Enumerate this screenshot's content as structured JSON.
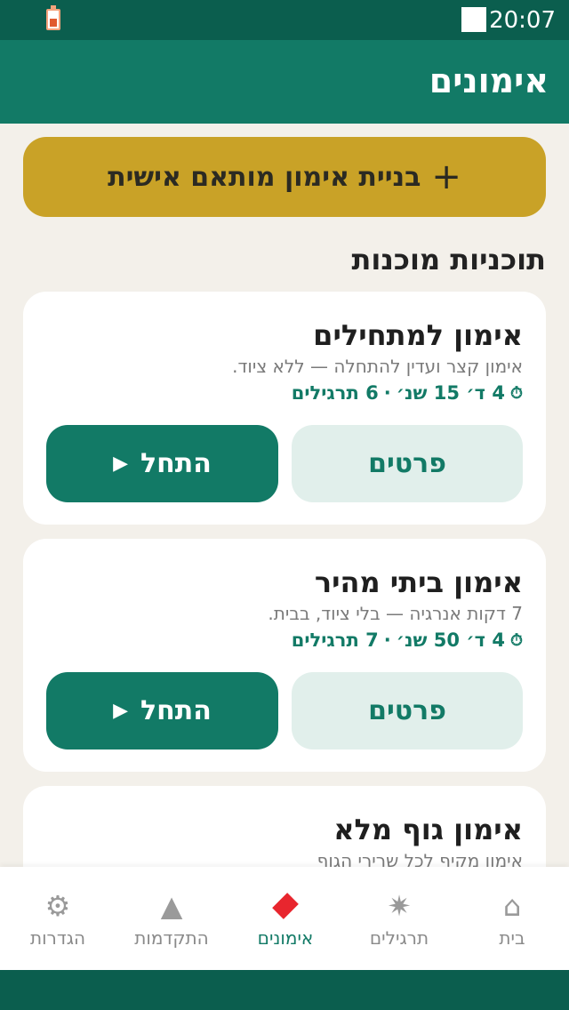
{
  "status_bar": {
    "time": "20:07"
  },
  "app_bar": {
    "title": "אימונים"
  },
  "build_button": {
    "icon": "plus-icon",
    "label": "בניית אימון מותאם אישית"
  },
  "section": {
    "title": "תוכניות מוכנות"
  },
  "workouts": [
    {
      "title": "אימון למתחילים",
      "description": "אימון קצר ועדין להתחלה — ללא ציוד.",
      "duration": "4 ד׳ 15 שנ׳",
      "separator": "·",
      "exercises": "6 תרגילים",
      "details_label": "פרטים",
      "start_label": "התחל"
    },
    {
      "title": "אימון ביתי מהיר",
      "description": "7 דקות אנרגיה — בלי ציוד, בבית.",
      "duration": "4 ד׳ 50 שנ׳",
      "separator": "·",
      "exercises": "7 תרגילים",
      "details_label": "פרטים",
      "start_label": "התחל"
    },
    {
      "title": "אימון גוף מלא",
      "description": "אימון מקיף לכל שרירי הגוף"
    }
  ],
  "nav": [
    {
      "label": "בית",
      "icon": "home-icon"
    },
    {
      "label": "תרגילים",
      "icon": "burst-icon"
    },
    {
      "label": "אימונים",
      "icon": "diamond-icon",
      "active": true
    },
    {
      "label": "התקדמות",
      "icon": "triangle-icon"
    },
    {
      "label": "הגדרות",
      "icon": "gear-icon"
    }
  ],
  "colors": {
    "primary": "#127a66",
    "dark": "#0b5e4e",
    "accent": "#c9a227",
    "active_icon": "#e8262e"
  }
}
